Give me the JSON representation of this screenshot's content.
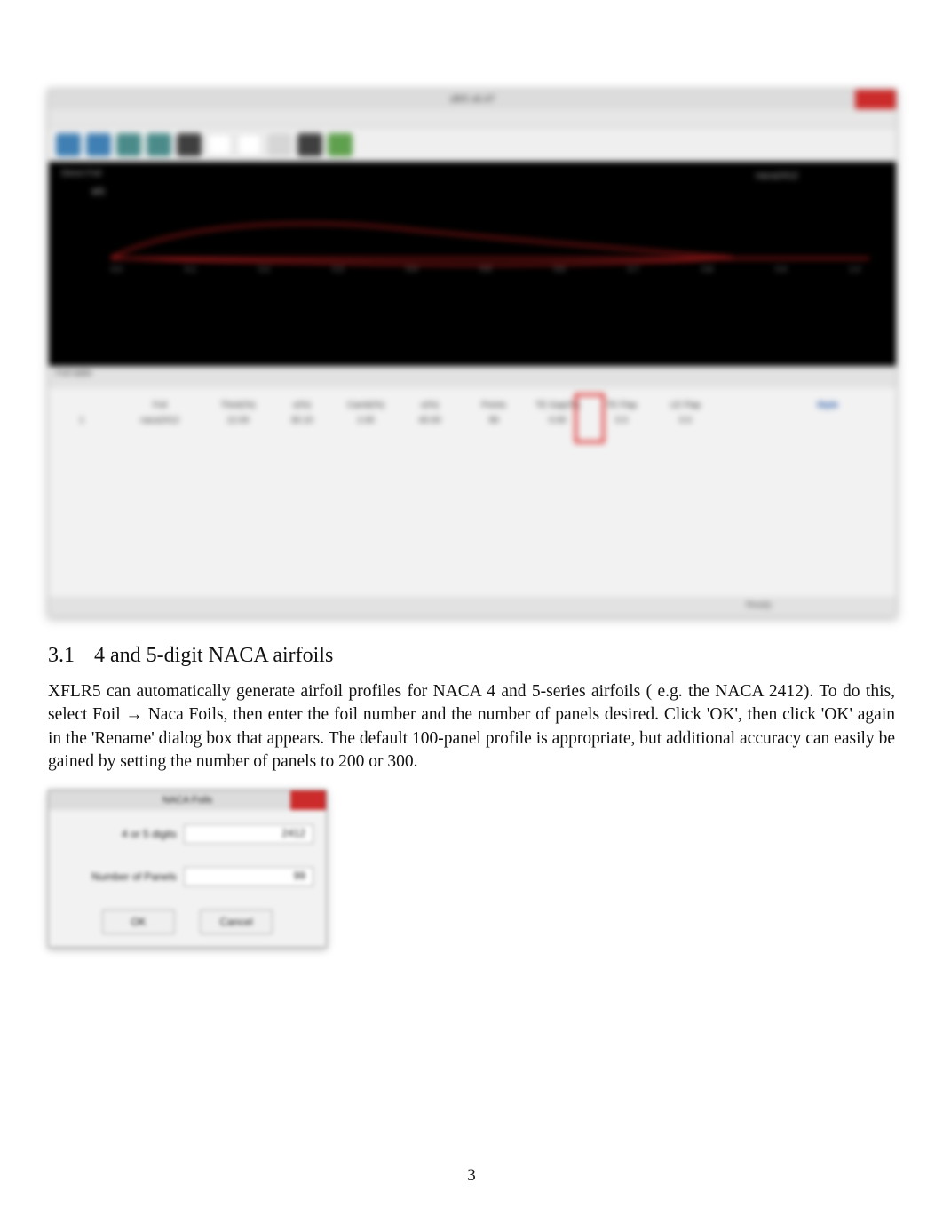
{
  "app": {
    "title": "xflr5 v6.47",
    "black_panel": {
      "corner": "Direct Foil",
      "axis_label": "x/c",
      "right_label": "naca2412",
      "ticks": [
        "0.0",
        "0.1",
        "0.2",
        "0.3",
        "0.4",
        "0.5",
        "0.6",
        "0.7",
        "0.8",
        "0.9",
        "1.0"
      ]
    },
    "table": {
      "section_label": "Foil table",
      "header_row": [
        "",
        "Foil",
        "Thick(%)",
        "x(%)",
        "Camb(%)",
        "x(%)",
        "Points",
        "TE Gap(%)",
        "TE Flap",
        "LE Flap",
        "",
        "Style"
      ],
      "data_row": [
        "1",
        "naca2412",
        "12.00",
        "30.10",
        "2.00",
        "40.00",
        "99",
        "0.00",
        "0.0",
        "0.0",
        "",
        ""
      ]
    },
    "status": "Ready"
  },
  "section": {
    "number": "3.1",
    "title": "4 and 5-digit NACA airfoils"
  },
  "body_paragraph": "XFLR5 can automatically generate airfoil profiles for NACA 4 and 5-series airfoils (  e.g. the NACA 2412). To do this, select Foil → Naca Foils, then enter the foil number and the number of panels desired. Click 'OK', then click 'OK' again in the 'Rename' dialog box that appears. The default 100-panel profile is appropriate, but additional accuracy can easily be gained by setting the number of panels to 200 or 300.",
  "dialog": {
    "title": "NACA Foils",
    "field1_label": "4 or 5 digits",
    "field1_value": "2412",
    "field2_label": "Number of Panels",
    "field2_value": "99",
    "ok_label": "OK",
    "cancel_label": "Cancel"
  },
  "page_number": "3"
}
